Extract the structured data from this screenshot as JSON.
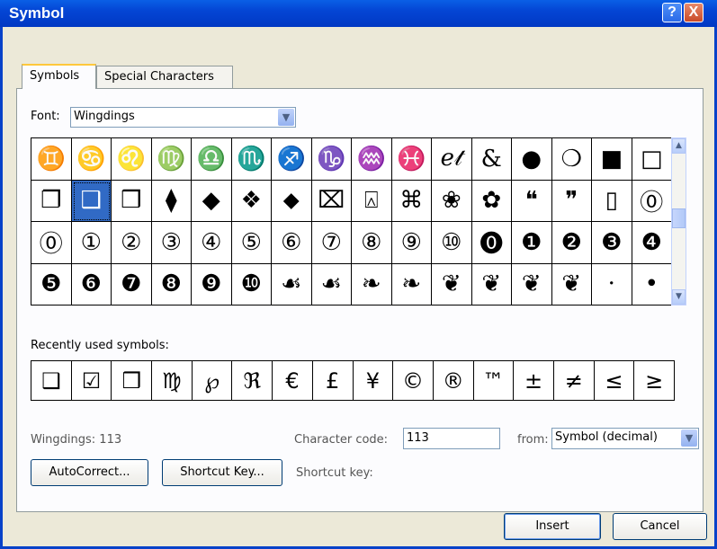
{
  "dialog": {
    "title": "Symbol",
    "help": "?",
    "close": "X"
  },
  "tabs": [
    {
      "label": "Symbols",
      "active": true
    },
    {
      "label": "Special Characters",
      "active": false
    }
  ],
  "font": {
    "label": "Font:",
    "value": "Wingdings"
  },
  "grid": {
    "rows": [
      [
        "♊",
        "♋",
        "♌",
        "♍",
        "♎",
        "♏",
        "♐",
        "♑",
        "♒",
        "♓",
        "ℯ𝓉",
        "&",
        "●",
        "❍",
        "■",
        "□"
      ],
      [
        "❐",
        "❑",
        "❒",
        "⧫",
        "◆",
        "❖",
        "⬥",
        "⌧",
        "⍓",
        "⌘",
        "❀",
        "✿",
        "❝",
        "❞",
        "▯",
        "⓪"
      ],
      [
        "⓪",
        "①",
        "②",
        "③",
        "④",
        "⑤",
        "⑥",
        "⑦",
        "⑧",
        "⑨",
        "⑩",
        "⓿",
        "❶",
        "❷",
        "❸",
        "❹"
      ],
      [
        "❺",
        "❻",
        "❼",
        "❽",
        "❾",
        "❿",
        "☙",
        "☙",
        "❧",
        "❧",
        "❦",
        "❦",
        "❦",
        "❦",
        "·",
        "•"
      ]
    ],
    "selected_row": 1,
    "selected_col": 1
  },
  "recent": {
    "label": "Recently used symbols:",
    "symbols": [
      "❑",
      "☑",
      "❒",
      "♍",
      "℘",
      "ℜ",
      "€",
      "£",
      "¥",
      "©",
      "®",
      "™",
      "±",
      "≠",
      "≤",
      "≥"
    ]
  },
  "status": {
    "font_code": "Wingdings: 113"
  },
  "char_code": {
    "label": "Character code:",
    "value": "113"
  },
  "from": {
    "label": "from:",
    "value": "Symbol (decimal)"
  },
  "buttons": {
    "autocorrect": "AutoCorrect...",
    "shortcut_key": "Shortcut Key...",
    "insert": "Insert",
    "cancel": "Cancel"
  },
  "shortcut": {
    "label": "Shortcut key:"
  }
}
